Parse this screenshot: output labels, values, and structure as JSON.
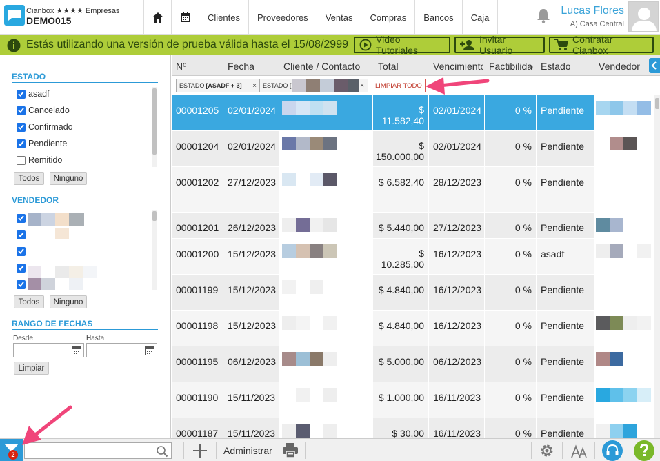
{
  "app": {
    "brand": "Cianbox ★★★★ Empresas",
    "company": "DEMO015"
  },
  "nav": {
    "items": [
      "Clientes",
      "Proveedores",
      "Ventas",
      "Compras",
      "Bancos",
      "Caja"
    ]
  },
  "user": {
    "name": "Lucas Flores",
    "branch": "A) Casa Central"
  },
  "banner": {
    "text": "Estás utilizando una versión de prueba válida hasta el 15/08/2999",
    "video_label": "Video Tutoriales",
    "invite_label": "Invitar Usuario",
    "contract_label": "Contratar Cianbox"
  },
  "sidebar": {
    "estado_title": "ESTADO",
    "estado_items": [
      {
        "label": "asadf",
        "checked": true
      },
      {
        "label": "Cancelado",
        "checked": true
      },
      {
        "label": "Confirmado",
        "checked": true
      },
      {
        "label": "Pendiente",
        "checked": true
      },
      {
        "label": "Remitido",
        "checked": false
      }
    ],
    "todos_label": "Todos",
    "ninguno_label": "Ninguno",
    "vendedor_title": "VENDEDOR",
    "rango_title": "RANGO DE FECHAS",
    "desde_label": "Desde",
    "hasta_label": "Hasta",
    "limpiar_label": "Limpiar"
  },
  "table": {
    "columns": [
      "Nº",
      "Fecha",
      "Cliente / Contacto",
      "Total",
      "Vencimiento",
      "Factibilidad",
      "Estado",
      "Vendedor"
    ],
    "chips": {
      "estado_prefix": "ESTADO ",
      "estado_value": "[ASADF + 3]",
      "vendedor_prefix": "ESTADO [",
      "clear_label": "LIMPIAR TODO",
      "close": "×"
    },
    "rows": [
      {
        "num": "00001205",
        "fecha": "02/01/2024",
        "total": "$ 11.582,40",
        "total_wrap": true,
        "venc": "02/01/2024",
        "fact": "0 %",
        "estado": "Pendiente",
        "selected": true
      },
      {
        "num": "00001204",
        "fecha": "02/01/2024",
        "total": "$ 150.000,00",
        "total_wrap": true,
        "venc": "02/01/2024",
        "fact": "0 %",
        "estado": "Pendiente"
      },
      {
        "num": "00001202",
        "fecha": "27/12/2023",
        "total": "$ 6.582,40",
        "venc": "28/12/2023",
        "fact": "0 %",
        "estado": "Pendiente"
      },
      {
        "num": "00001201",
        "fecha": "26/12/2023",
        "total": "$ 5.440,00",
        "venc": "27/12/2023",
        "fact": "0 %",
        "estado": "Pendiente"
      },
      {
        "num": "00001200",
        "fecha": "15/12/2023",
        "total": "$ 10.285,00",
        "total_wrap": true,
        "venc": "16/12/2023",
        "fact": "0 %",
        "estado": "asadf"
      },
      {
        "num": "00001199",
        "fecha": "15/12/2023",
        "total": "$ 4.840,00",
        "venc": "16/12/2023",
        "fact": "0 %",
        "estado": "Pendiente"
      },
      {
        "num": "00001198",
        "fecha": "15/12/2023",
        "total": "$ 4.840,00",
        "venc": "16/12/2023",
        "fact": "0 %",
        "estado": "Pendiente"
      },
      {
        "num": "00001195",
        "fecha": "06/12/2023",
        "total": "$ 5.000,00",
        "venc": "06/12/2023",
        "fact": "0 %",
        "estado": "Pendiente"
      },
      {
        "num": "00001190",
        "fecha": "15/11/2023",
        "total": "$ 1.000,00",
        "venc": "16/11/2023",
        "fact": "0 %",
        "estado": "Pendiente"
      },
      {
        "num": "00001187",
        "fecha": "15/11/2023",
        "total": "$ 30,00",
        "venc": "16/11/2023",
        "fact": "0 %",
        "estado": "Pendiente"
      }
    ]
  },
  "bottombar": {
    "filter_badge": "2",
    "admin_label": "Administrar",
    "search_value": ""
  },
  "colors": {
    "accent": "#2c9ad7",
    "banner": "#aecd39",
    "selected_row": "#3aa8e0",
    "arrow": "#f0457a"
  },
  "icons": [
    "home-icon",
    "calendar-icon",
    "bell-icon",
    "info-icon",
    "play-icon",
    "add-user-icon",
    "cart-icon",
    "filter-icon",
    "search-icon",
    "plus-icon",
    "printer-icon",
    "gear-icon",
    "font-size-icon",
    "headset-icon",
    "help-icon"
  ]
}
